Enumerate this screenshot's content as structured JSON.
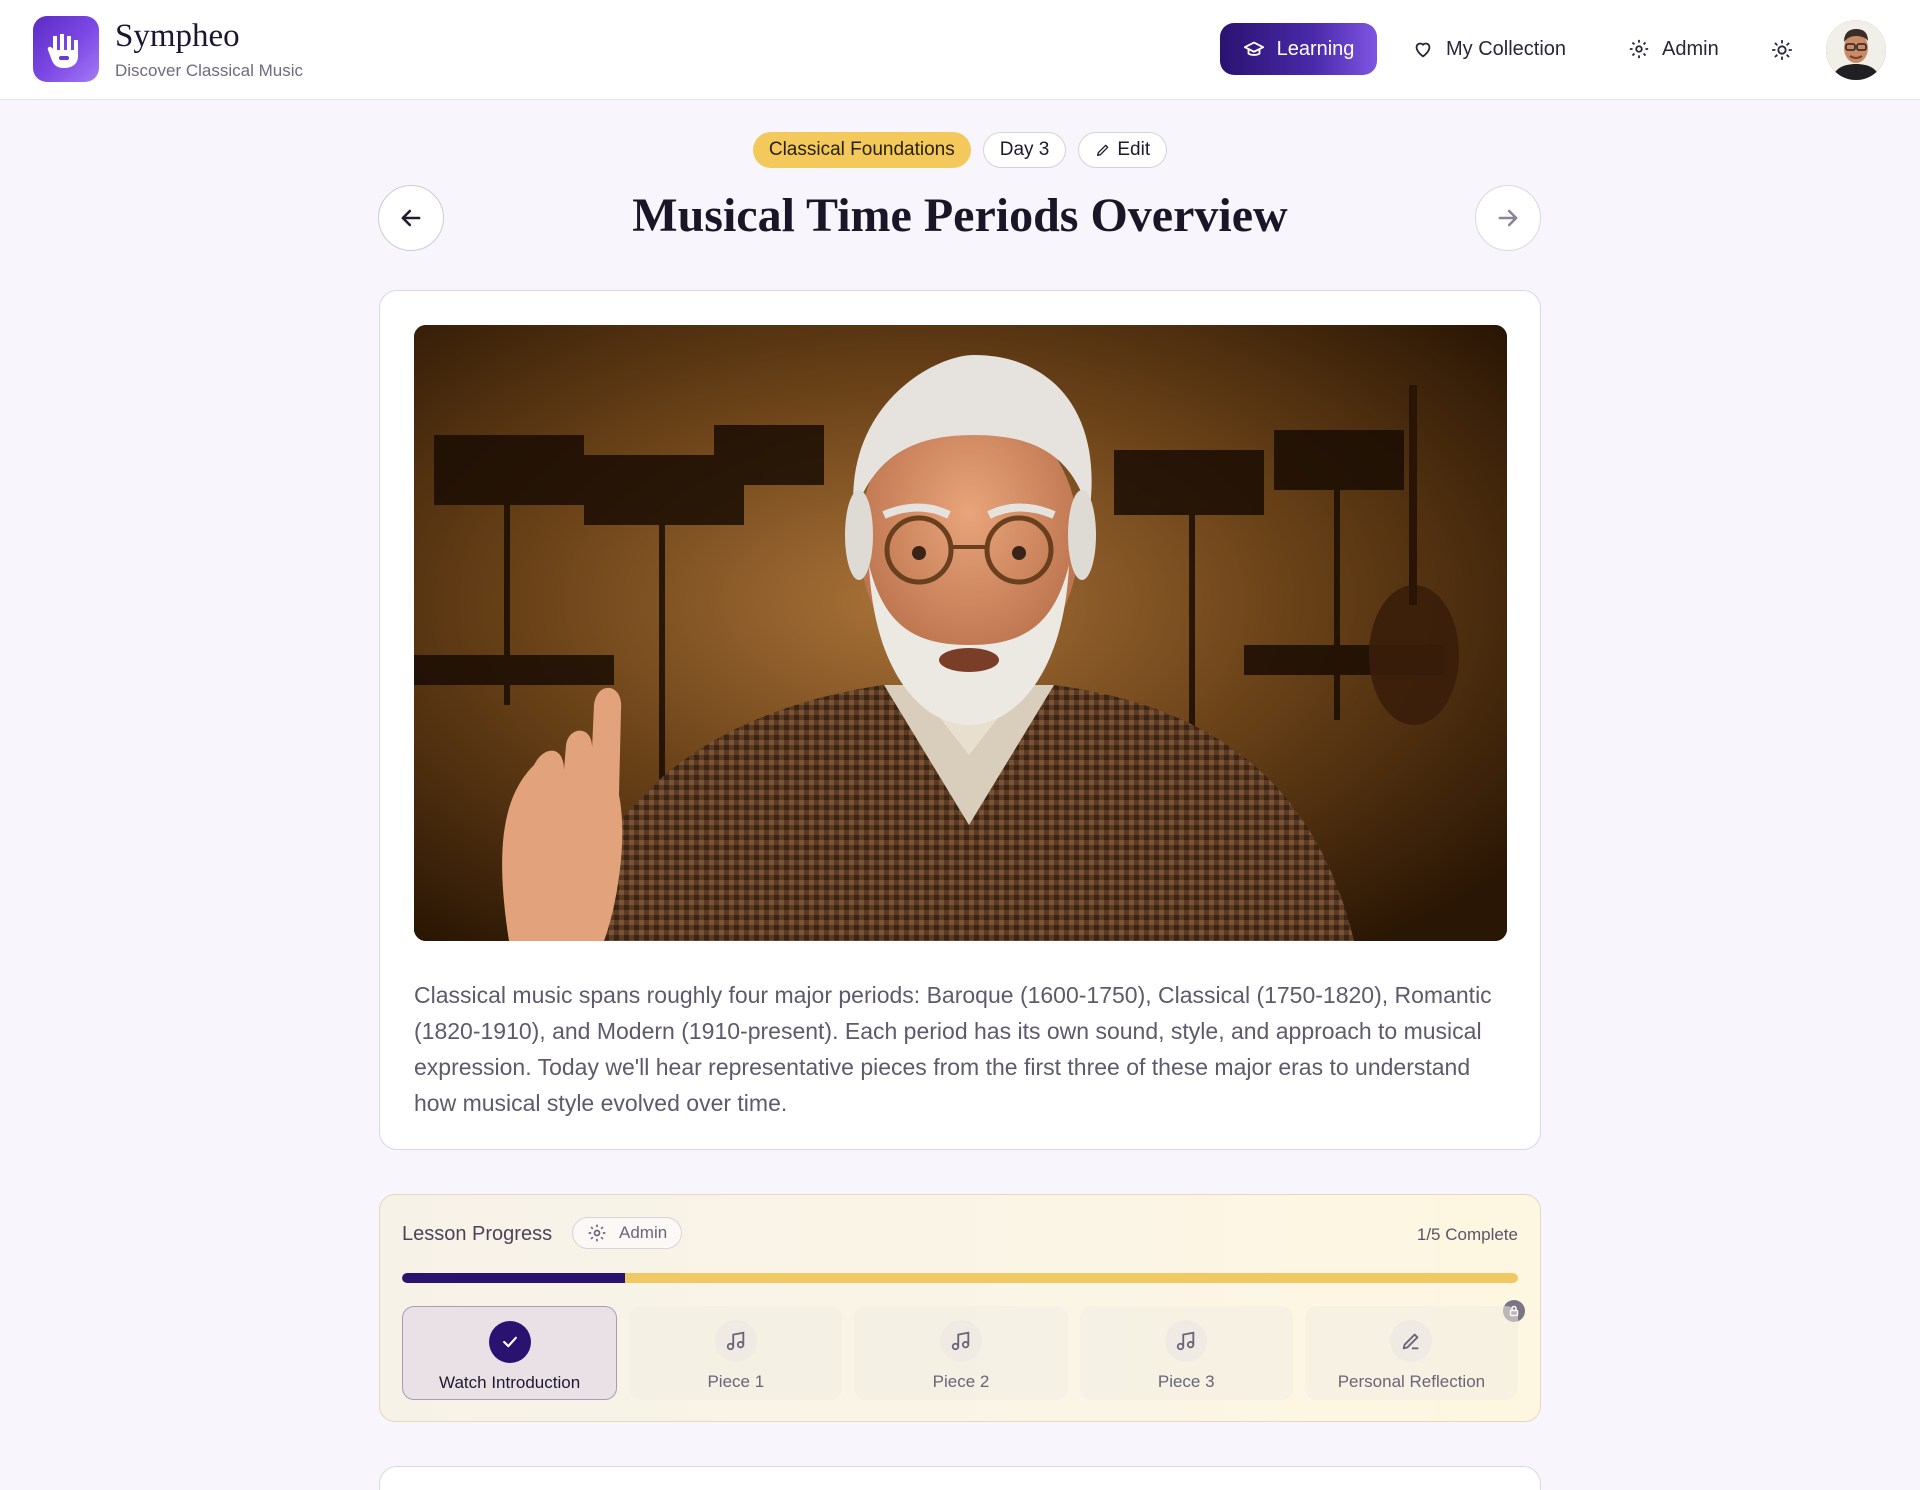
{
  "app": {
    "name": "Sympheo",
    "tagline": "Discover Classical Music"
  },
  "nav": {
    "learning": "Learning",
    "collection": "My Collection",
    "admin": "Admin"
  },
  "lesson": {
    "course_badge": "Classical Foundations",
    "day_badge": "Day 3",
    "edit_label": "Edit",
    "title": "Musical Time Periods Overview",
    "description": "Classical music spans roughly four major periods: Baroque (1600-1750), Classical (1750-1820), Romantic (1820-1910), and Modern (1910-present). Each period has its own sound, style, and approach to musical expression. Today we'll hear representative pieces from the first three of these major eras to understand how musical style evolved over time."
  },
  "progress": {
    "label": "Lesson Progress",
    "admin_label": "Admin",
    "count": "1/5 Complete",
    "fraction": 0.2,
    "steps": [
      {
        "label": "Watch Introduction",
        "icon": "check-icon",
        "done": true
      },
      {
        "label": "Piece 1",
        "icon": "music-note-icon",
        "done": false
      },
      {
        "label": "Piece 2",
        "icon": "music-note-icon",
        "done": false
      },
      {
        "label": "Piece 3",
        "icon": "music-note-icon",
        "done": false
      },
      {
        "label": "Personal Reflection",
        "icon": "pencil-icon",
        "done": false
      }
    ]
  },
  "colors": {
    "accent": "#2a1270",
    "course_badge": "#f2c95a",
    "progress_track": "#f1c962"
  }
}
